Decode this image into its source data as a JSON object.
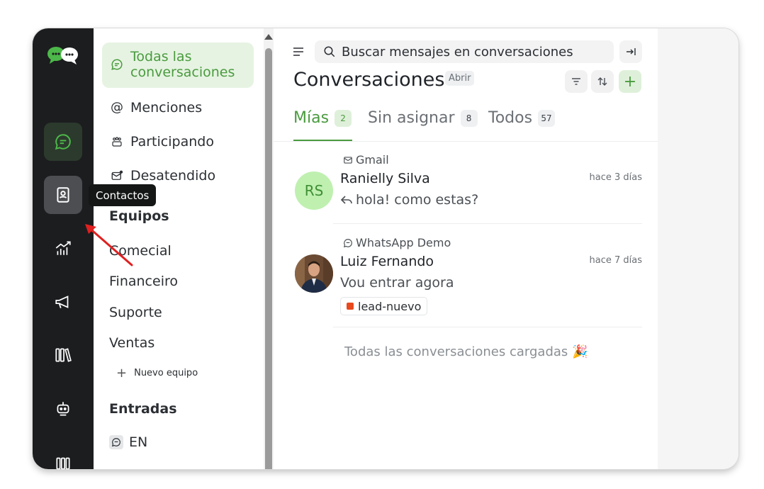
{
  "sidebar": {
    "active_item": "Todas las conversaciones",
    "items": [
      {
        "label": "Menciones",
        "icon": "at-icon"
      },
      {
        "label": "Participando",
        "icon": "people-icon"
      },
      {
        "label": "Desatendido",
        "icon": "mail-unread-icon"
      }
    ],
    "teams_heading": "Equipos",
    "teams": [
      "Comecial",
      "Financeiro",
      "Suporte",
      "Ventas"
    ],
    "new_team_label": "Nuevo equipo",
    "inboxes_heading": "Entradas",
    "inboxes": [
      {
        "label": "EN",
        "icon": "chat-icon"
      }
    ]
  },
  "tooltip": "Contactos",
  "search": {
    "placeholder": "Buscar mensajes en conversaciones"
  },
  "header": {
    "title": "Conversaciones",
    "status": "Abrir"
  },
  "tabs": [
    {
      "label": "Mías",
      "count": "2",
      "active": true
    },
    {
      "label": "Sin asignar",
      "count": "8",
      "active": false
    },
    {
      "label": "Todos",
      "count": "57",
      "active": false
    }
  ],
  "conversations": [
    {
      "inbox": "Gmail",
      "inbox_icon": "mail-icon",
      "initials": "RS",
      "name": "Ranielly Silva",
      "time": "hace 3 días",
      "message": "hola! como estas?",
      "message_icon": "reply-icon"
    },
    {
      "inbox": "WhatsApp Demo",
      "inbox_icon": "chat-icon",
      "name": "Luiz Fernando",
      "time": "hace 7 días",
      "message": "Vou entrar agora",
      "label": "lead-nuevo",
      "label_color": "#e8491d"
    }
  ],
  "footer_text": "Todas las conversaciones cargadas 🎉",
  "colors": {
    "accent": "#4a9b3f",
    "accent_bg": "#e6f3e2",
    "rail": "#1c1d1f",
    "annotation_arrow": "#e02020"
  }
}
